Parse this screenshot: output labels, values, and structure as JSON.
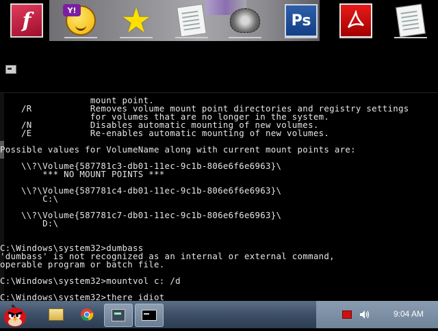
{
  "desktop": {
    "icons": [
      {
        "name": "flash-icon",
        "symbol": "f"
      },
      {
        "name": "yahoo-messenger-icon",
        "symbol": "Y!"
      },
      {
        "name": "star-icon",
        "symbol": "★"
      },
      {
        "name": "document-icon",
        "symbol": ""
      },
      {
        "name": "hedgehog-icon",
        "symbol": ""
      },
      {
        "name": "photoshop-icon",
        "symbol": "Ps"
      },
      {
        "name": "acrobat-icon",
        "symbol": ""
      },
      {
        "name": "document-icon-2",
        "symbol": ""
      }
    ]
  },
  "console": {
    "lines": [
      "                 mount point.",
      "    /R           Removes volume mount point directories and registry settings",
      "                 for volumes that are no longer in the system.",
      "    /N           Disables automatic mounting of new volumes.",
      "    /E           Re-enables automatic mounting of new volumes.",
      "",
      "Possible values for VolumeName along with current mount points are:",
      "",
      "    \\\\?\\Volume{587781c3-db01-11ec-9c1b-806e6f6e6963}\\",
      "        *** NO MOUNT POINTS ***",
      "",
      "    \\\\?\\Volume{587781c4-db01-11ec-9c1b-806e6f6e6963}\\",
      "        C:\\",
      "",
      "    \\\\?\\Volume{587781c7-db01-11ec-9c1b-806e6f6e6963}\\",
      "        D:\\",
      "",
      "",
      "C:\\Windows\\system32>dumbass",
      "'dumbass' is not recognized as an internal or external command,",
      "operable program or batch file.",
      "",
      "C:\\Windows\\system32>mountvol c: /d",
      "",
      "C:\\Windows\\system32>there idiot"
    ]
  },
  "taskbar": {
    "start_icon": "angry-bird-start-icon",
    "buttons": [
      "explorer-icon",
      "chrome-icon",
      "app-icon",
      "cmd-icon"
    ],
    "clock": "9:04 AM"
  }
}
